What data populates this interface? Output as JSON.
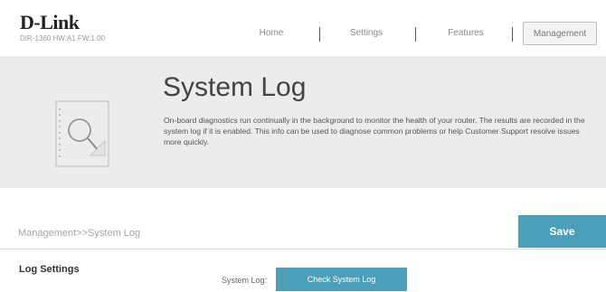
{
  "brand": {
    "logo_text": "D-Link",
    "model_text": "DIR-1360 HW:A1 FW:1.00"
  },
  "nav": {
    "items": [
      {
        "label": "Home",
        "active": false
      },
      {
        "label": "Settings",
        "active": false
      },
      {
        "label": "Features",
        "active": false
      },
      {
        "label": "Management",
        "active": true
      }
    ]
  },
  "banner": {
    "title": "System Log",
    "description": "On-board diagnostics run continually in the background to monitor the health of your router. The results are recorded in the system log if it is enabled. This info can be used to diagnose common problems or help Customer Support resolve issues more quickly.",
    "icon": "magnifier-document-icon"
  },
  "breadcrumb": "Management>>System Log",
  "save_label": "Save",
  "log_settings": {
    "section_title": "Log Settings",
    "system_log_label": "System Log:",
    "check_button_label": "Check System Log"
  },
  "colors": {
    "accent": "#4b9fb8",
    "banner_bg": "#ececec"
  }
}
